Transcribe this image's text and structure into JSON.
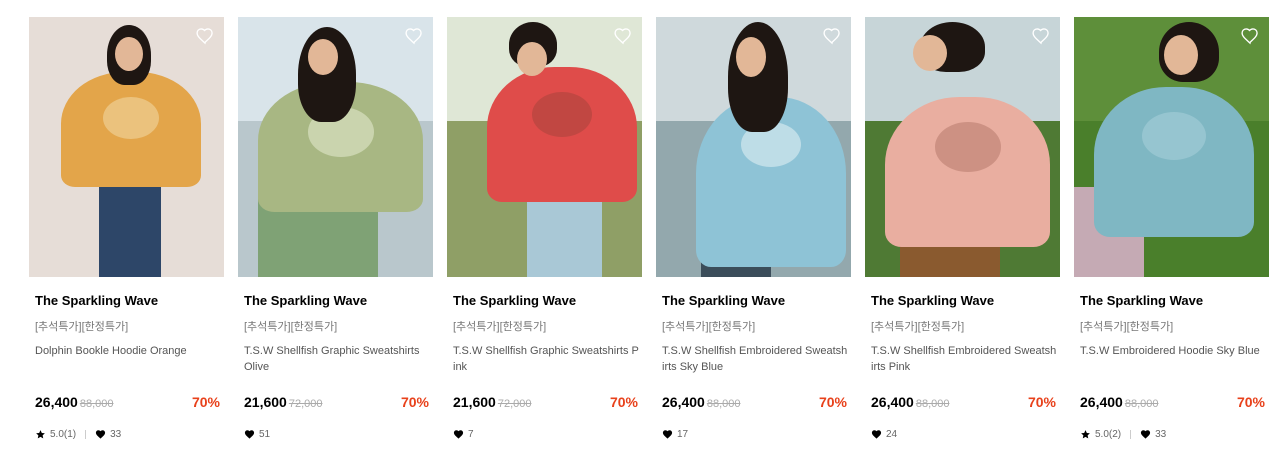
{
  "products": [
    {
      "brand": "The Sparkling Wave",
      "tag": "[추석특가][한정특가]",
      "name": "Dolphin Bookle Hoodie Orange",
      "price": "26,400",
      "original_price": "88,000",
      "discount": "70%",
      "rating": "5.0(1)",
      "likes": "33",
      "colors": {
        "bg": "#e6ddd7",
        "ground": "#e6ddd7",
        "top": "#e3a54a",
        "bottom": "#2d4668",
        "print": "#f3dba8"
      }
    },
    {
      "brand": "The Sparkling Wave",
      "tag": "[추석특가][한정특가]",
      "name": "T.S.W Shellfish Graphic Sweatshirts Olive",
      "price": "21,600",
      "original_price": "72,000",
      "discount": "70%",
      "rating": "",
      "likes": "51",
      "colors": {
        "bg": "#d9e4ea",
        "ground": "#b9c7cc",
        "top": "#a8b783",
        "bottom": "#7fa275",
        "print": "#e6ecd2"
      }
    },
    {
      "brand": "The Sparkling Wave",
      "tag": "[추석특가][한정특가]",
      "name": "T.S.W Shellfish Graphic Sweatshirts Pink",
      "price": "21,600",
      "original_price": "72,000",
      "discount": "70%",
      "rating": "",
      "likes": "7",
      "colors": {
        "bg": "#dfe7d6",
        "ground": "#8f9f66",
        "top": "#df4c4a",
        "bottom": "#a9c8d6",
        "print": "#a7433c"
      }
    },
    {
      "brand": "The Sparkling Wave",
      "tag": "[추석특가][한정특가]",
      "name": "T.S.W Shellfish Embroidered Sweatshirts Sky Blue",
      "price": "26,400",
      "original_price": "88,000",
      "discount": "70%",
      "rating": "",
      "likes": "17",
      "colors": {
        "bg": "#cfd9dc",
        "ground": "#93a8ad",
        "top": "#8ec3d6",
        "bottom": "#3b4d5a",
        "print": "#e6f2f5"
      }
    },
    {
      "brand": "The Sparkling Wave",
      "tag": "[추석특가][한정특가]",
      "name": "T.S.W Shellfish Embroidered Sweatshirts Pink",
      "price": "26,400",
      "original_price": "88,000",
      "discount": "70%",
      "rating": "",
      "likes": "24",
      "colors": {
        "bg": "#c7d5d8",
        "ground": "#4f7a34",
        "top": "#e9aea0",
        "bottom": "#8a5a2f",
        "print": "#b67a6c"
      }
    },
    {
      "brand": "The Sparkling Wave",
      "tag": "[추석특가][한정특가]",
      "name": "T.S.W Embroidered Hoodie Sky Blue",
      "price": "26,400",
      "original_price": "88,000",
      "discount": "70%",
      "rating": "5.0(2)",
      "likes": "33",
      "colors": {
        "bg": "#5e8f3a",
        "ground": "#4a7f2b",
        "top": "#7fb7c3",
        "bottom": "#c5aab4",
        "print": "#a9d2da"
      }
    }
  ],
  "accent_color": "#e8411b",
  "icons": {
    "wishlist": "heart-outline-icon",
    "rating": "star-icon",
    "likes": "heart-icon"
  }
}
